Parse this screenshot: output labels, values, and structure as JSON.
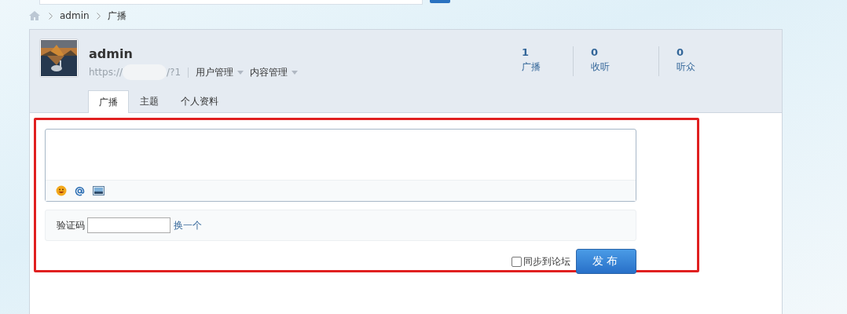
{
  "breadcrumb": [
    "admin",
    "广播"
  ],
  "profile": {
    "name": "admin",
    "url_start": "https://",
    "url_end": "/?1",
    "menus": [
      "用户管理",
      "内容管理"
    ],
    "stats": [
      {
        "value": "1",
        "label": "广播"
      },
      {
        "value": "0",
        "label": "收听"
      },
      {
        "value": "0",
        "label": "听众"
      }
    ]
  },
  "tabs": [
    {
      "label": "广播",
      "selected": true
    },
    {
      "label": "主题",
      "selected": false
    },
    {
      "label": "个人资料",
      "selected": false
    }
  ],
  "composer": {
    "captcha_label": "验证码",
    "captcha_refresh": "换一个",
    "sync": {
      "label": "同步到论坛",
      "checked": false
    },
    "submit": "发布"
  }
}
